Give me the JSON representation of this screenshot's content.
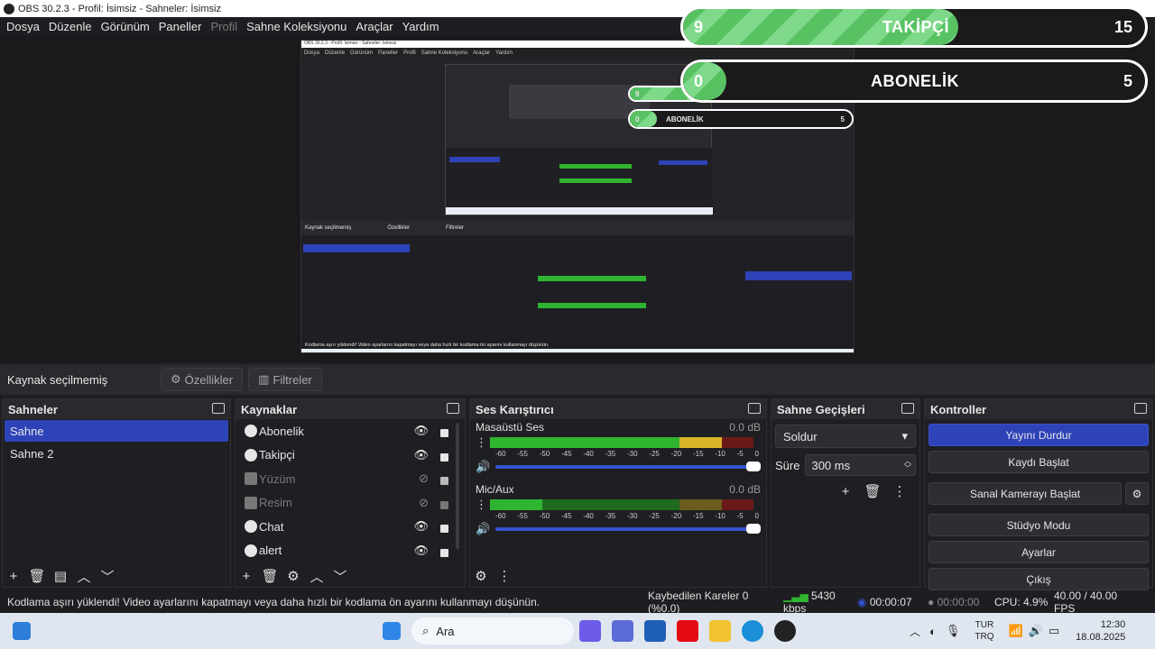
{
  "window": {
    "title": "OBS 30.2.3 - Profil: İsimsiz - Sahneler: İsimsiz"
  },
  "menu": [
    "Dosya",
    "Düzenle",
    "Görünüm",
    "Paneller",
    "Profil",
    "Sahne Koleksiyonu",
    "Araçlar",
    "Yardım"
  ],
  "overlay": {
    "followers": {
      "count_left": "9",
      "label": "TAKİPÇİ",
      "count_right": "15"
    },
    "subscribers": {
      "count_left": "0",
      "label": "ABONELİK",
      "count_right": "5"
    }
  },
  "preview": {
    "mini_title": "OBS 30.2.3 - Profil: İsimsiz - Sahneler: İsimsiz",
    "mini_menu": [
      "Dosya",
      "Düzenle",
      "Görünüm",
      "Paneller",
      "Profil",
      "Sahne Koleksiyonu",
      "Araçlar",
      "Yardım"
    ],
    "mini_status": "Kodlama aşırı yüklendi! Video ayarlarını kapatmayı veya daha hızlı bir kodlama ön ayarını kullanmayı düşünün.",
    "mini_no_source": "Kaynak seçilmemiş",
    "mini_props": "Özellikler",
    "mini_filters": "Filtreler"
  },
  "source_bar": {
    "no_source": "Kaynak seçilmemiş",
    "properties": "Özellikler",
    "filters": "Filtreler"
  },
  "scenes": {
    "title": "Sahneler",
    "items": [
      {
        "label": "Sahne",
        "selected": true
      },
      {
        "label": "Sahne 2",
        "selected": false
      }
    ]
  },
  "sources": {
    "title": "Kaynaklar",
    "items": [
      {
        "label": "Abonelik",
        "icon": "browser-icon",
        "visible": true
      },
      {
        "label": "Takipçi",
        "icon": "browser-icon",
        "visible": true
      },
      {
        "label": "Yüzüm",
        "icon": "camera-icon",
        "visible": false
      },
      {
        "label": "Resim",
        "icon": "image-icon",
        "visible": false
      },
      {
        "label": "Chat",
        "icon": "browser-icon",
        "visible": true
      },
      {
        "label": "alert",
        "icon": "browser-icon",
        "visible": true
      }
    ]
  },
  "mixer": {
    "title": "Ses Karıştırıcı",
    "scale": [
      "-60",
      "-55",
      "-50",
      "-45",
      "-40",
      "-35",
      "-30",
      "-25",
      "-20",
      "-15",
      "-10",
      "-5",
      "0"
    ],
    "tracks": [
      {
        "label": "Masaüstü Ses",
        "db": "0.0 dB"
      },
      {
        "label": "Mic/Aux",
        "db": "0.0 dB"
      }
    ]
  },
  "transitions": {
    "title": "Sahne Geçişleri",
    "selected": "Soldur",
    "duration_label": "Süre",
    "duration_value": "300 ms"
  },
  "controls": {
    "title": "Kontroller",
    "stop_stream": "Yayını Durdur",
    "start_record": "Kaydı Başlat",
    "virtual_cam": "Sanal Kamerayı Başlat",
    "studio": "Stüdyo Modu",
    "settings": "Ayarlar",
    "exit": "Çıkış"
  },
  "status": {
    "warning": "Kodlama aşırı yüklendi! Video ayarlarını kapatmayı veya daha hızlı bir kodlama ön ayarını kullanmayı düşünün.",
    "dropped": "Kaybedilen Kareler 0 (%0.0)",
    "bitrate": "5430 kbps",
    "stream_time": "00:00:07",
    "rec_time": "00:00:00",
    "cpu": "CPU: 4.9%",
    "fps": "40.00 / 40.00 FPS"
  },
  "taskbar": {
    "search": "Ara",
    "lang_top": "TUR",
    "lang_bottom": "TRQ",
    "time": "12:30",
    "date": "18.08.2025"
  }
}
